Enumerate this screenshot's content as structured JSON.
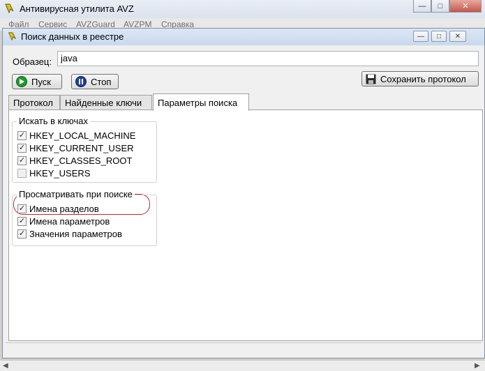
{
  "app": {
    "title": "Антивирусная утилита AVZ",
    "menu": [
      "Файл",
      "Сервис",
      "AVZGuard",
      "AVZPM",
      "Справка"
    ]
  },
  "dialog": {
    "title": "Поиск данных в реестре",
    "sample_label": "Образец:",
    "sample_value": "java",
    "start_label": "Пуск",
    "stop_label": "Стоп",
    "save_label": "Сохранить протокол",
    "tabs": [
      "Протокол",
      "Найденные ключи",
      "Параметры поиска"
    ],
    "active_tab": "Параметры поиска",
    "groups": {
      "keys": {
        "title": "Искать в ключах",
        "items": [
          {
            "label": "HKEY_LOCAL_MACHINE",
            "checked": true
          },
          {
            "label": "HKEY_CURRENT_USER",
            "checked": true
          },
          {
            "label": "HKEY_CLASSES_ROOT",
            "checked": true
          },
          {
            "label": "HKEY_USERS",
            "checked": false
          }
        ]
      },
      "scan": {
        "title": "Просматривать при поиске",
        "items": [
          {
            "label": "Имена разделов",
            "checked": true
          },
          {
            "label": "Имена параметров",
            "checked": true
          },
          {
            "label": "Значения параметров",
            "checked": true
          }
        ]
      }
    }
  },
  "colors": {
    "highlight_ring": "#c0282e",
    "start_icon": "#1e9a2e",
    "stop_icon": "#1f3e9c"
  },
  "icons": {
    "app": "avz-app-icon",
    "start": "play-icon",
    "stop": "pause-icon",
    "save": "floppy-disk-icon"
  }
}
